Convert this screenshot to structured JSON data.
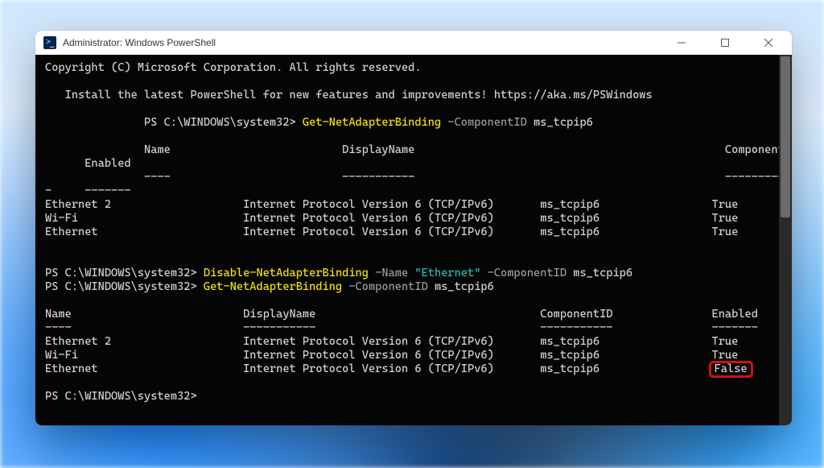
{
  "window": {
    "title": "Administrator: Windows PowerShell"
  },
  "banner": {
    "copyright": "Copyright (C) Microsoft Corporation. All rights reserved.",
    "install": "Install the latest PowerShell for new features and improvements! https://aka.ms/PSWindows"
  },
  "prompt": "PS C:\\WINDOWS\\system32> ",
  "cmd1": {
    "cmdlet": "Get-NetAdapterBinding",
    "param": " -ComponentID ",
    "arg": "ms_tcpip6"
  },
  "cmd2": {
    "cmdlet": "Disable-NetAdapterBinding",
    "paramName": " -Name ",
    "argName": "\"Ethernet\"",
    "paramComp": " -ComponentID ",
    "argComp": "ms_tcpip6"
  },
  "cmd3": {
    "cmdlet": "Get-NetAdapterBinding",
    "param": " -ComponentID ",
    "arg": "ms_tcpip6"
  },
  "table1": {
    "headers": {
      "name": "Name",
      "display": "DisplayName",
      "comp": "ComponentID",
      "enabled": "Enabled"
    },
    "dashes": {
      "name": "----",
      "display": "-----------",
      "comp": "-----------",
      "enabled": "-------"
    },
    "rows": [
      {
        "name": "Ethernet 2",
        "display": "Internet Protocol Version 6 (TCP/IPv6)",
        "comp": "ms_tcpip6",
        "enabled": "True"
      },
      {
        "name": "Wi-Fi",
        "display": "Internet Protocol Version 6 (TCP/IPv6)",
        "comp": "ms_tcpip6",
        "enabled": "True"
      },
      {
        "name": "Ethernet",
        "display": "Internet Protocol Version 6 (TCP/IPv6)",
        "comp": "ms_tcpip6",
        "enabled": "True"
      }
    ]
  },
  "table2": {
    "headers": {
      "name": "Name",
      "display": "DisplayName",
      "comp": "ComponentID",
      "enabled": "Enabled"
    },
    "dashes": {
      "name": "----",
      "display": "-----------",
      "comp": "-----------",
      "enabled": "-------"
    },
    "rows": [
      {
        "name": "Ethernet 2",
        "display": "Internet Protocol Version 6 (TCP/IPv6)",
        "comp": "ms_tcpip6",
        "enabled": "True"
      },
      {
        "name": "Wi-Fi",
        "display": "Internet Protocol Version 6 (TCP/IPv6)",
        "comp": "ms_tcpip6",
        "enabled": "True"
      },
      {
        "name": "Ethernet",
        "display": "Internet Protocol Version 6 (TCP/IPv6)",
        "comp": "ms_tcpip6",
        "enabled": "False",
        "highlight": true
      }
    ]
  },
  "cols": {
    "name": 30,
    "display": 45,
    "comp": 17,
    "enabled": 7
  },
  "cols1": {
    "lead": 15,
    "name": 30,
    "display": 45,
    "comp": 17,
    "enabled": 7
  }
}
